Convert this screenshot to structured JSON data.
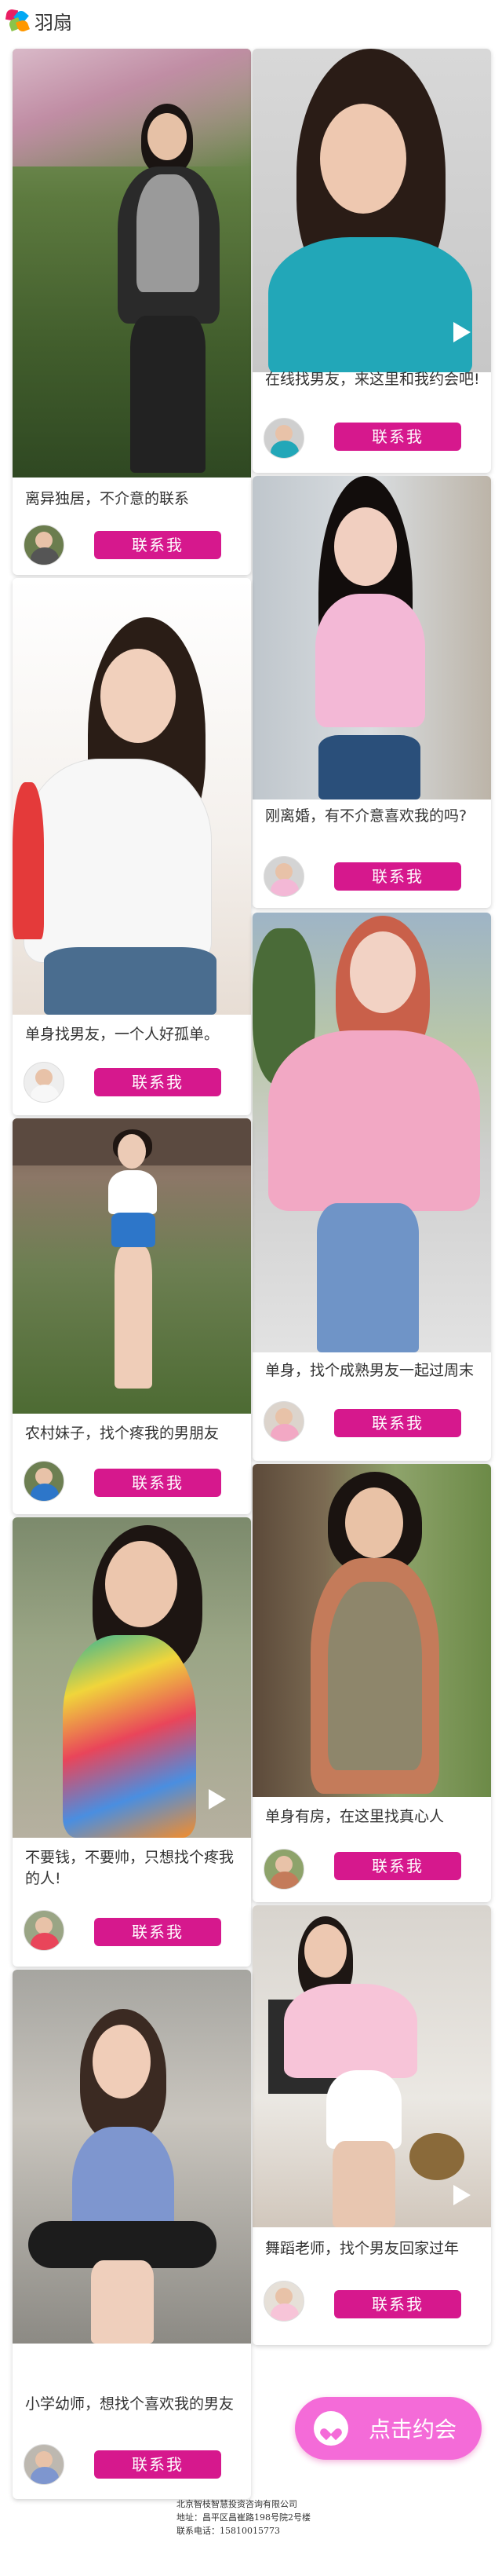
{
  "header": {
    "logo_text": "羽扇"
  },
  "profiles": [
    {
      "caption": "离异独居，不介意的联系",
      "button": "联系我",
      "has_video": false
    },
    {
      "caption": "在线找男友，来这里和我约会吧!",
      "button": "联系我",
      "has_video": true
    },
    {
      "caption": "刚离婚，有不介意喜欢我的吗?",
      "button": "联系我",
      "has_video": false
    },
    {
      "caption": "单身找男友，一个人好孤单。",
      "button": "联系我",
      "has_video": false
    },
    {
      "caption": "单身，找个成熟男友一起过周末",
      "button": "联系我",
      "has_video": false
    },
    {
      "caption": "农村妹子，找个疼我的男朋友",
      "button": "联系我",
      "has_video": false
    },
    {
      "caption": "单身有房，在这里找真心人",
      "button": "联系我",
      "has_video": false
    },
    {
      "caption": "不要钱，不要帅，只想找个疼我的人!",
      "button": "联系我",
      "has_video": true
    },
    {
      "caption": "舞蹈老师，找个男友回家过年",
      "button": "联系我",
      "has_video": true
    },
    {
      "caption": "小学幼师，想找个喜欢我的男友",
      "button": "联系我",
      "has_video": false
    }
  ],
  "cta": {
    "label": "点击约会"
  },
  "footer": {
    "company": "北京智枝智慧投资咨询有限公司",
    "address": "地址：昌平区昌崔路198号院2号楼",
    "phone": "联系电话：15810015773"
  },
  "colors": {
    "accent": "#d6188d",
    "cta": "#f46bd8"
  }
}
